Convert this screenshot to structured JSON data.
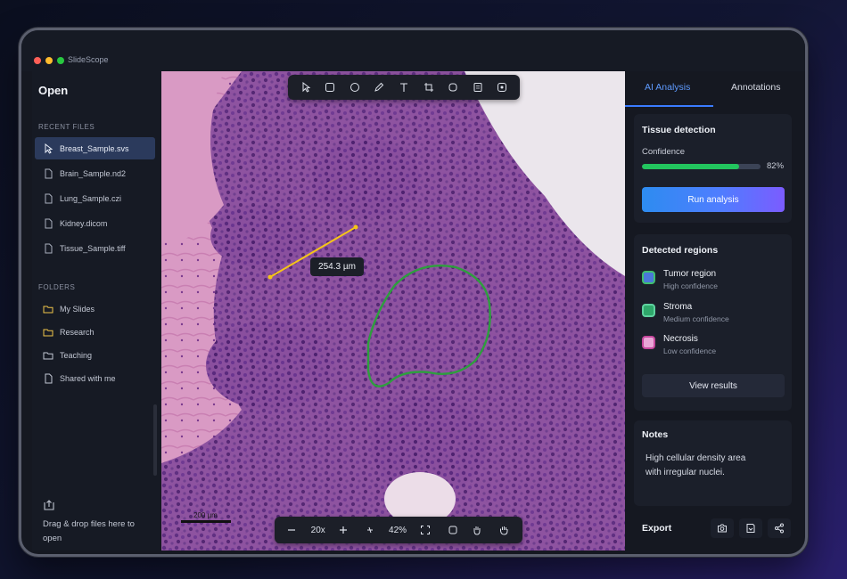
{
  "app": {
    "title": "SlideScope"
  },
  "sidebar": {
    "title": "Open",
    "recent_label": "RECENT FILES",
    "files": [
      {
        "name": "Breast_Sample.svs",
        "active": true
      },
      {
        "name": "Brain_Sample.nd2",
        "active": false
      },
      {
        "name": "Lung_Sample.czi",
        "active": false
      },
      {
        "name": "Kidney.dicom",
        "active": false
      },
      {
        "name": "Tissue_Sample.tiff",
        "active": false
      }
    ],
    "folders_label": "FOLDERS",
    "folders": [
      {
        "name": "My Slides",
        "icon": "folder-icon"
      },
      {
        "name": "Research",
        "icon": "folder-icon"
      },
      {
        "name": "Teaching",
        "icon": "folder-icon"
      },
      {
        "name": "Shared with me",
        "icon": "shared-file-icon"
      }
    ],
    "dropzone": {
      "icon": "upload-icon",
      "text": "Drag & drop files here to open"
    }
  },
  "viewer": {
    "tools": [
      "pointer-icon",
      "rectangle-icon",
      "ellipse-icon",
      "pen-icon",
      "text-icon",
      "crop-icon",
      "polygon-icon",
      "note-icon",
      "region-icon"
    ],
    "measurement": "254.3 µm",
    "scale_bar": "200 µm",
    "magnification": "20x",
    "zoom": "42%",
    "colors": {
      "measure_line": "#f5c518",
      "region_outline": "#2e9e3e"
    }
  },
  "right_panel": {
    "tabs": [
      {
        "label": "AI Analysis",
        "active": true
      },
      {
        "label": "Annotations",
        "active": false
      }
    ],
    "tissue": {
      "title": "Tissue detection",
      "confidence_label": "Confidence",
      "confidence_value": "82%",
      "confidence_fraction": 0.82,
      "run_button": "Run analysis"
    },
    "regions": {
      "title": "Detected regions",
      "items": [
        {
          "name": "Tumor region",
          "confidence": "High confidence",
          "color": "#4a78d8",
          "border": "#3fbf6e"
        },
        {
          "name": "Stroma",
          "confidence": "Medium confidence",
          "color": "#2fa86b",
          "border": "#5fd3a0"
        },
        {
          "name": "Necrosis",
          "confidence": "Low confidence",
          "color": "#e9a6d6",
          "border": "#c5479c"
        }
      ],
      "view_button": "View results"
    },
    "notes": {
      "title": "Notes",
      "text": "High cellular density area with irregular nuclei."
    },
    "export": {
      "label": "Export",
      "actions": [
        "camera-icon",
        "save-icon",
        "share-icon"
      ]
    }
  }
}
